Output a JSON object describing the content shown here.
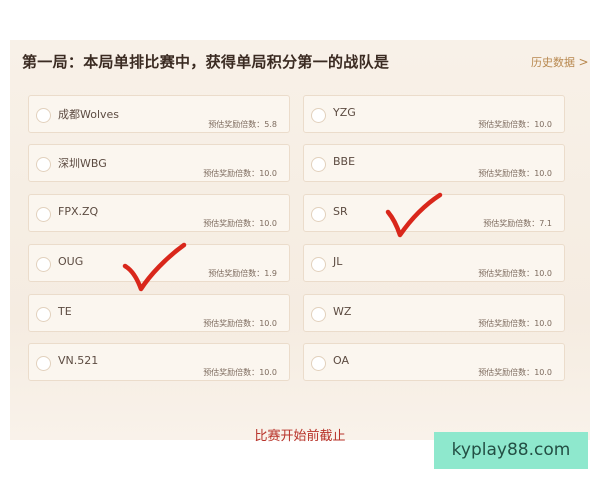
{
  "question": "第一局：本局单排比赛中，获得单局积分第一的战队是",
  "history_link": "历史数据",
  "history_chevron": ">",
  "odds_label": "预估奖励倍数：",
  "options_left": [
    {
      "team": "成都Wolves",
      "odds": "5.8",
      "checked": false
    },
    {
      "team": "深圳WBG",
      "odds": "10.0",
      "checked": false
    },
    {
      "team": "FPX.ZQ",
      "odds": "10.0",
      "checked": false
    },
    {
      "team": "OUG",
      "odds": "1.9",
      "checked": true
    },
    {
      "team": "TE",
      "odds": "10.0",
      "checked": false
    },
    {
      "team": "VN.521",
      "odds": "10.0",
      "checked": false
    }
  ],
  "options_right": [
    {
      "team": "YZG",
      "odds": "10.0",
      "checked": false
    },
    {
      "team": "BBE",
      "odds": "10.0",
      "checked": false
    },
    {
      "team": "SR",
      "odds": "7.1",
      "checked": true
    },
    {
      "team": "JL",
      "odds": "10.0",
      "checked": false
    },
    {
      "team": "WZ",
      "odds": "10.0",
      "checked": false
    },
    {
      "team": "OA",
      "odds": "10.0",
      "checked": false
    }
  ],
  "deadline_text": "比赛开始前截止",
  "watermark": "kyplay88.com",
  "colors": {
    "accent": "#b8332a",
    "check_mark": "#d9271b",
    "watermark_bg": "#8ee8cd"
  }
}
